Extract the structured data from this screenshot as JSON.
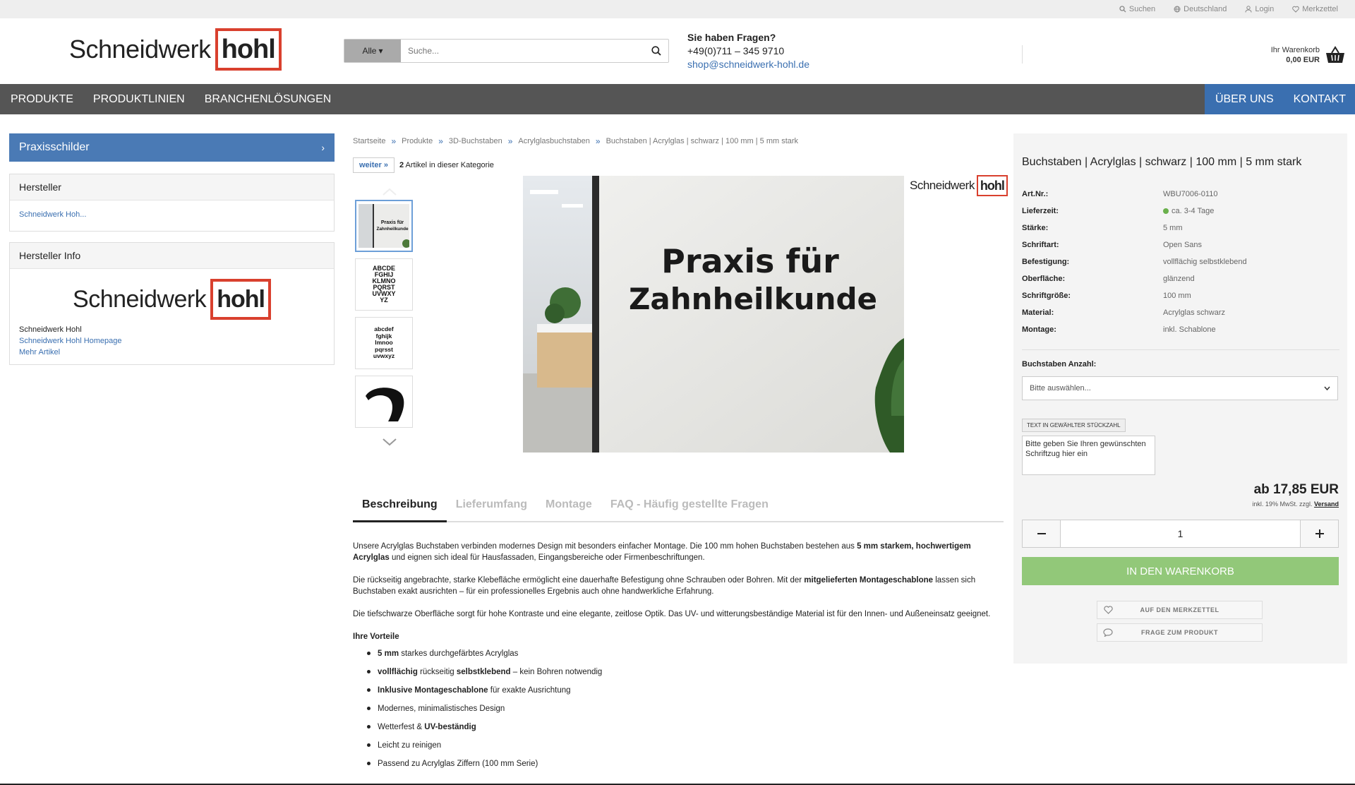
{
  "topbar": {
    "search": "Suchen",
    "country": "Deutschland",
    "login": "Login",
    "wishlist": "Merkzettel"
  },
  "logo": {
    "text": "Schneidwerk",
    "box": "hohl"
  },
  "search": {
    "category": "Alle",
    "placeholder": "Suche..."
  },
  "contact": {
    "question": "Sie haben Fragen?",
    "phone": "+49(0)711 – 345 9710",
    "email": "shop@schneidwerk-hohl.de"
  },
  "cart": {
    "label": "Ihr Warenkorb",
    "amount": "0,00 EUR"
  },
  "nav": {
    "left": [
      "PRODUKTE",
      "PRODUKTLINIEN",
      "BRANCHENLÖSUNGEN"
    ],
    "right": [
      "ÜBER UNS",
      "KONTAKT"
    ]
  },
  "sidebar": {
    "category": "Praxisschilder",
    "manufacturer_title": "Hersteller",
    "manufacturer_link": "Schneidwerk Hoh...",
    "info_title": "Hersteller Info",
    "info_name": "Schneidwerk Hohl",
    "info_homepage": "Schneidwerk Hohl Homepage",
    "info_more": "Mehr Artikel"
  },
  "breadcrumb": {
    "items": [
      "Startseite",
      "Produkte",
      "3D-Buchstaben",
      "Acrylglasbuchstaben",
      "Buchstaben | Acrylglas | schwarz | 100 mm | 5 mm stark"
    ],
    "sep": "»"
  },
  "nav_article": {
    "next": "weiter »",
    "count": "2",
    "count_text": "Artikel in dieser Kategorie"
  },
  "image": {
    "line1": "Praxis für",
    "line2": "Zahnheilkunde",
    "thumb2": [
      "ABCDE",
      "FGHIJ",
      "KLMNO",
      "PQRST",
      "UVWXY",
      "YZ"
    ],
    "thumb3": [
      "abcdef",
      "fghijk",
      "lmnoo",
      "pqrsst",
      "uvwxyz"
    ]
  },
  "tabs": [
    "Beschreibung",
    "Lieferumfang",
    "Montage",
    "FAQ - Häufig gestellte Fragen"
  ],
  "description": {
    "p1a": "Unsere Acrylglas Buchstaben verbinden modernes Design mit besonders einfacher Montage. Die 100 mm hohen Buchstaben bestehen aus ",
    "p1b": "5 mm starkem, hochwertigem Acrylglas",
    "p1c": " und eignen sich ideal für Hausfassaden, Eingangsbereiche oder Firmenbeschriftungen.",
    "p2a": "Die rückseitig angebrachte, starke Klebefläche ermöglicht eine dauerhafte Befestigung ohne Schrauben oder Bohren. Mit der ",
    "p2b": "mitgelieferten Montageschablone",
    "p2c": " lassen sich Buchstaben exakt ausrichten – für ein professionelles Ergebnis auch ohne handwerkliche Erfahrung.",
    "p3": "Die tiefschwarze Oberfläche sorgt für hohe Kontraste und eine elegante, zeitlose Optik. Das UV- und witterungsbeständige Material ist für den Innen- und Außeneinsatz geeignet.",
    "benefits_title": "Ihre Vorteile",
    "b1a": "5 mm",
    "b1b": " starkes durchgefärbtes Acrylglas",
    "b2a": "vollflächig",
    "b2b": " rückseitig ",
    "b2c": "selbstklebend",
    "b2d": " – kein Bohren notwendig",
    "b3a": "Inklusive Montageschablone",
    "b3b": " für exakte Ausrichtung",
    "b4": "Modernes, minimalistisches Design",
    "b5a": "Wetterfest & ",
    "b5b": "UV-beständig",
    "b6": "Leicht zu reinigen",
    "b7": "Passend zu Acrylglas Ziffern (100 mm Serie)"
  },
  "product": {
    "title": "Buchstaben | Acrylglas | schwarz | 100 mm | 5 mm stark",
    "props": [
      {
        "k": "Art.Nr.:",
        "v": "WBU7006-0110"
      },
      {
        "k": "Lieferzeit:",
        "v": "ca. 3-4 Tage"
      },
      {
        "k": "Stärke:",
        "v": "5 mm"
      },
      {
        "k": "Schriftart:",
        "v": "Open Sans"
      },
      {
        "k": "Befestigung:",
        "v": "vollflächig selbstklebend"
      },
      {
        "k": "Oberfläche:",
        "v": "glänzend"
      },
      {
        "k": "Schriftgröße:",
        "v": "100 mm"
      },
      {
        "k": "Material:",
        "v": "Acrylglas schwarz"
      },
      {
        "k": "Montage:",
        "v": "inkl. Schablone"
      }
    ],
    "letters_label": "Buchstaben Anzahl:",
    "select_value": "Bitte auswählen...",
    "text_tag": "TEXT IN GEWÄHLTER STÜCKZAHL",
    "text_placeholder": "Bitte geben Sie Ihren gewünschten Schriftzug hier ein",
    "price": "ab 17,85 EUR",
    "tax": "inkl. 19% MwSt. zzgl.",
    "shipping": "Versand",
    "qty": "1",
    "add_to_cart": "IN DEN WARENKORB",
    "wishlist": "AUF DEN MERKZETTEL",
    "ask": "FRAGE ZUM PRODUKT"
  },
  "colors": {
    "accent": "#3a6fb0",
    "nav": "#555555",
    "cta": "#92c879",
    "brand_red": "#d9402e"
  }
}
